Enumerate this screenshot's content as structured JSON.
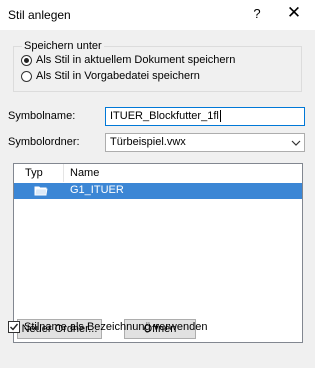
{
  "window": {
    "title": "Stil anlegen",
    "help_label": "?",
    "close_label": "✕"
  },
  "save_group": {
    "legend": "Speichern unter",
    "options": [
      {
        "label": "Als Stil in aktuellem Dokument speichern",
        "checked": true
      },
      {
        "label": "Als Stil in Vorgabedatei speichern",
        "checked": false
      }
    ]
  },
  "symbol_name": {
    "label": "Symbolname:",
    "value": "ITUER_Blockfutter_1fl"
  },
  "symbol_folder": {
    "label": "Symbolordner:",
    "selected": "Türbeispiel.vwx"
  },
  "list": {
    "columns": [
      "Typ",
      "Name"
    ],
    "rows": [
      {
        "type_icon": "folder-icon",
        "name": "G1_ITUER",
        "selected": true
      }
    ]
  },
  "buttons": {
    "new_folder": "Neuer Ordner...",
    "open": "Öffnen"
  },
  "use_name_checkbox": {
    "label": "Stilname als Bezeichnung verwenden",
    "checked": true
  }
}
